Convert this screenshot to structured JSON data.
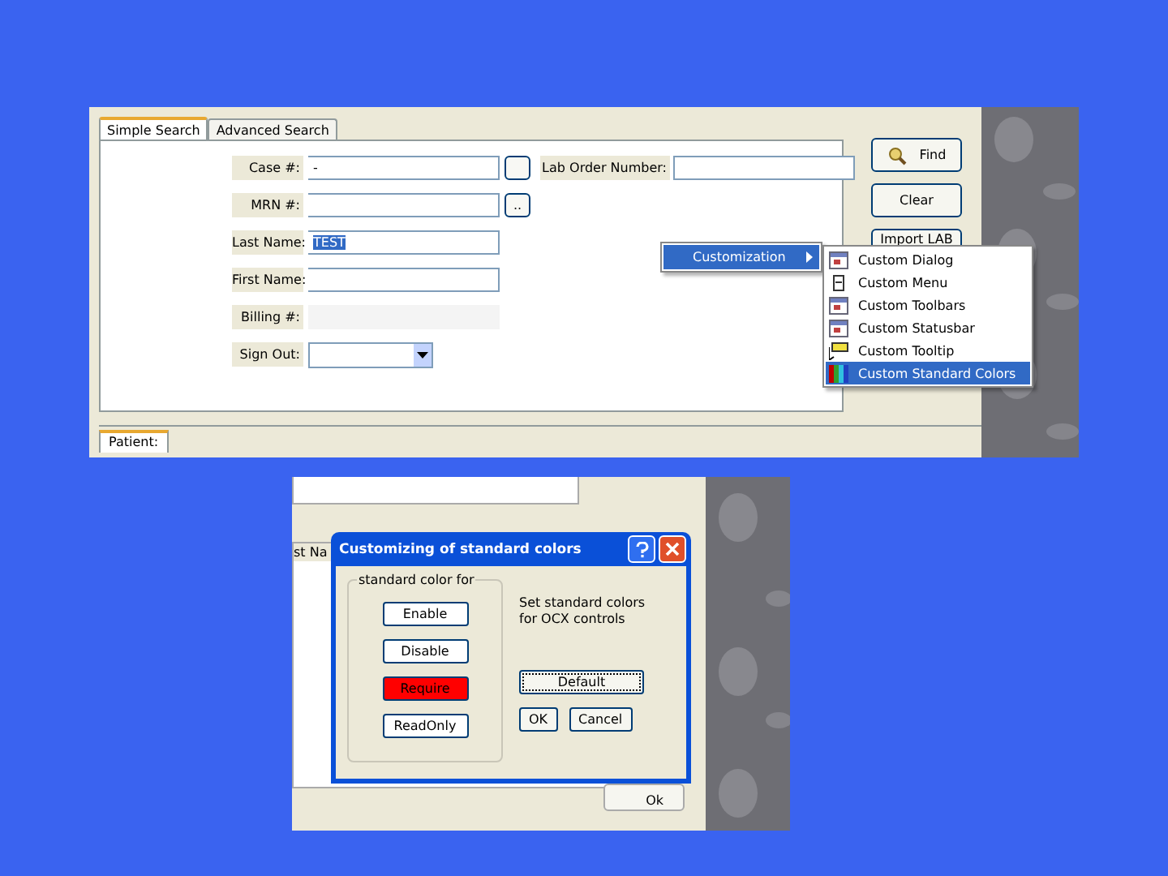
{
  "search_window": {
    "tabs": [
      {
        "label": "Simple Search",
        "selected": true
      },
      {
        "label": "Advanced Search",
        "selected": false
      }
    ],
    "fields": [
      {
        "label": "Case #:",
        "value": "-",
        "kind": "text",
        "has_button": true
      },
      {
        "label": "MRN #:",
        "kind": "text",
        "button": ".."
      },
      {
        "label": "Last Name:",
        "value": "TEST",
        "kind": "text",
        "highlighted": true
      },
      {
        "label": "First Name:",
        "kind": "text"
      },
      {
        "label": "Billing #:",
        "kind": "plain"
      },
      {
        "label": "Sign Out:",
        "kind": "select"
      }
    ],
    "lab_order": {
      "label": "Lab Order Number:"
    },
    "buttons": [
      {
        "label": "Find",
        "icon": true
      },
      {
        "label": "Clear"
      },
      {
        "label": "Import LAB"
      }
    ],
    "bottom_tab": "Patient:"
  },
  "context_menu": {
    "item": "Customization",
    "submenu": [
      {
        "label": "Custom Dialog",
        "selected": false
      },
      {
        "label": "Custom Menu",
        "selected": false
      },
      {
        "label": "Custom Toolbars",
        "selected": false
      },
      {
        "label": "Custom Statusbar",
        "selected": false
      },
      {
        "label": "Custom Tooltip",
        "selected": false
      },
      {
        "label": "Custom Standard Colors",
        "selected": true
      }
    ]
  },
  "background_window": {
    "column_heading": "st Na",
    "button": "Ok"
  },
  "dialog": {
    "title": "Customizing of standard colors",
    "group_label": "standard color for",
    "color_buttons": [
      {
        "label": "Enable",
        "color": "#ffffff"
      },
      {
        "label": "Disable",
        "color": "#ffffff"
      },
      {
        "label": "Require",
        "color": "#ff0000"
      },
      {
        "label": "ReadOnly",
        "color": "#ffffff"
      }
    ],
    "hint": "Set standard colors for OCX controls",
    "default_button": "Default",
    "buttons": [
      "OK",
      "Cancel"
    ]
  }
}
